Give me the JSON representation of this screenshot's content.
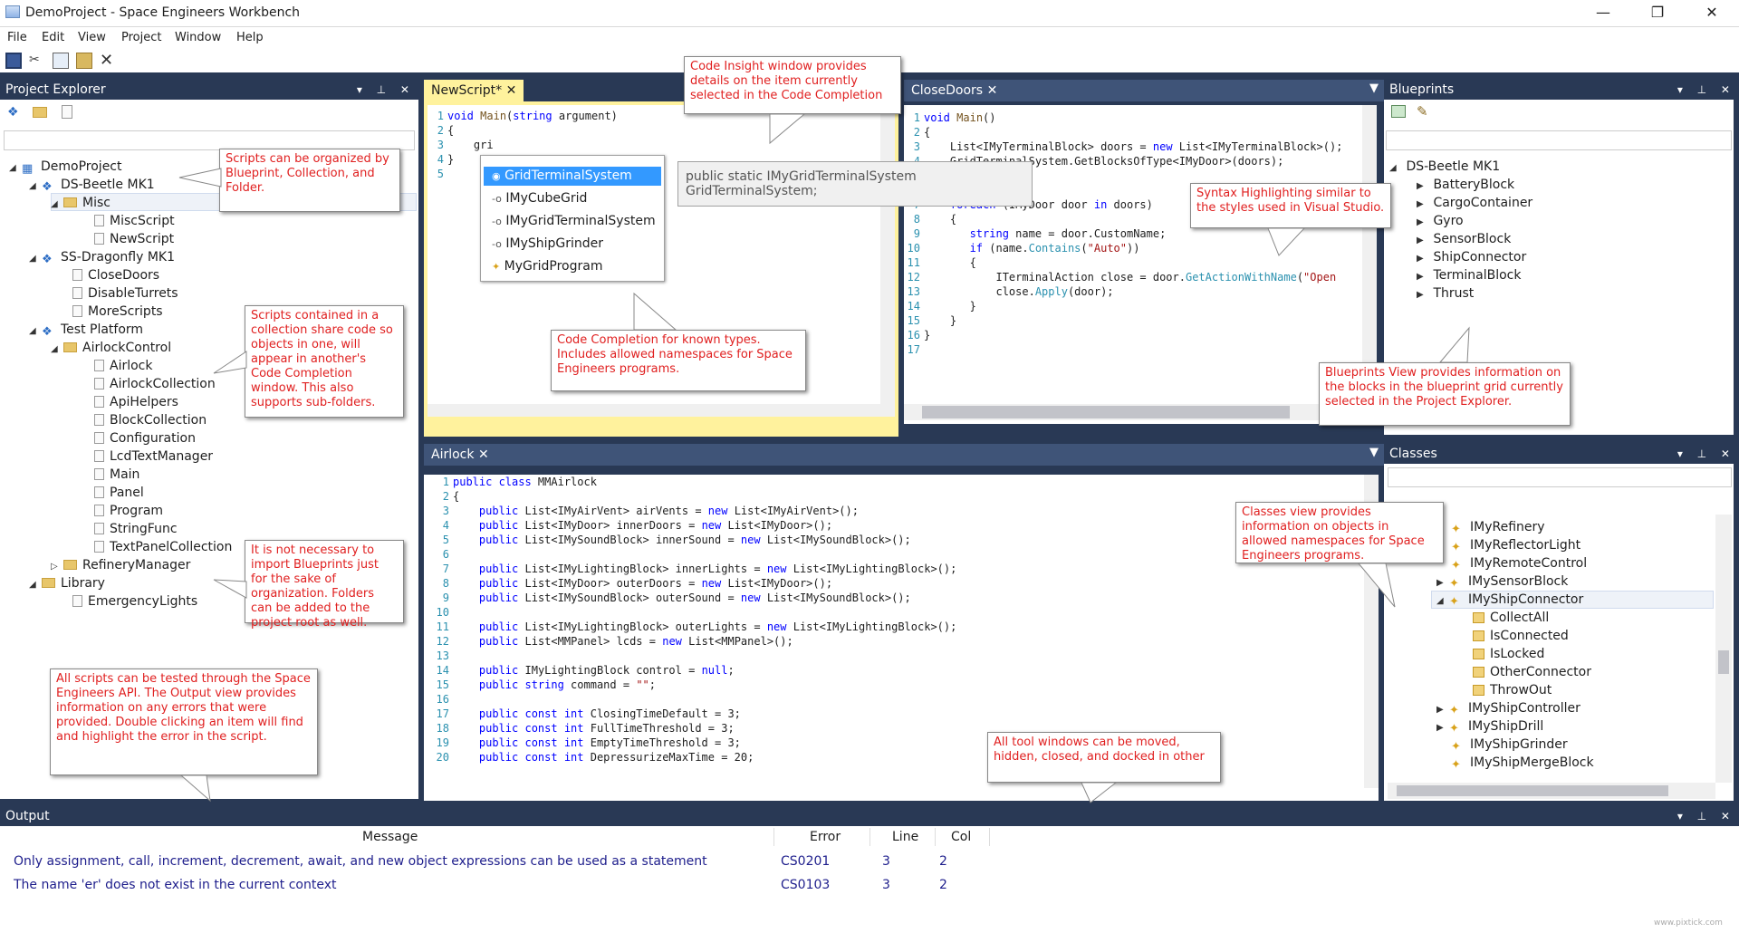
{
  "window": {
    "title": "DemoProject - Space Engineers Workbench"
  },
  "menu": [
    "File",
    "Edit",
    "View",
    "Project",
    "Window",
    "Help"
  ],
  "project_explorer": {
    "title": "Project Explorer",
    "items": [
      {
        "label": "DemoProject"
      },
      {
        "label": "DS-Beetle MK1"
      },
      {
        "label": "Misc"
      },
      {
        "label": "MiscScript"
      },
      {
        "label": "NewScript"
      },
      {
        "label": "SS-Dragonfly MK1"
      },
      {
        "label": "CloseDoors"
      },
      {
        "label": "DisableTurrets"
      },
      {
        "label": "MoreScripts"
      },
      {
        "label": "Test Platform"
      },
      {
        "label": "AirlockControl"
      },
      {
        "label": "Airlock"
      },
      {
        "label": "AirlockCollection"
      },
      {
        "label": "ApiHelpers"
      },
      {
        "label": "BlockCollection"
      },
      {
        "label": "Configuration"
      },
      {
        "label": "LcdTextManager"
      },
      {
        "label": "Main"
      },
      {
        "label": "Panel"
      },
      {
        "label": "Program"
      },
      {
        "label": "StringFunc"
      },
      {
        "label": "TextPanelCollection"
      },
      {
        "label": "RefineryManager"
      },
      {
        "label": "Library"
      },
      {
        "label": "EmergencyLights"
      }
    ]
  },
  "newscript": {
    "tab": "NewScript*",
    "completion": [
      "GridTerminalSystem",
      "IMyCubeGrid",
      "IMyGridTerminalSystem",
      "IMyShipGrinder",
      "MyGridProgram"
    ],
    "insight": "public static IMyGridTerminalSystem GridTerminalSystem;"
  },
  "closedoors": {
    "tab": "CloseDoors"
  },
  "airlock": {
    "tab": "Airlock"
  },
  "blueprints": {
    "title": "Blueprints",
    "root": "DS-Beetle MK1",
    "items": [
      "BatteryBlock",
      "CargoContainer",
      "Gyro",
      "SensorBlock",
      "ShipConnector",
      "TerminalBlock",
      "Thrust"
    ]
  },
  "classes": {
    "title": "Classes",
    "items": [
      "IMyRefinery",
      "IMyReflectorLight",
      "IMyRemoteControl",
      "IMySensorBlock",
      "IMyShipConnector"
    ],
    "members": [
      "CollectAll",
      "IsConnected",
      "IsLocked",
      "OtherConnector",
      "ThrowOut"
    ],
    "items2": [
      "IMyShipController",
      "IMyShipDrill",
      "IMyShipGrinder",
      "IMyShipMergeBlock"
    ]
  },
  "output": {
    "title": "Output",
    "columns": {
      "message": "Message",
      "error": "Error",
      "line": "Line",
      "col": "Col"
    },
    "rows": [
      {
        "message": "Only assignment, call, increment, decrement, await, and new object expressions can be used as a statement",
        "error": "CS0201",
        "line": "3",
        "col": "2"
      },
      {
        "message": "The name 'er' does not exist in the current context",
        "error": "CS0103",
        "line": "3",
        "col": "2"
      }
    ]
  },
  "callouts": {
    "organize": "Scripts can be organized by Blueprint, Collection, and Folder.",
    "collection": "Scripts contained in a collection share code so objects in one, will appear in another's Code Completion window. This also supports sub-folders.",
    "import": "It is not necessary to import Blueprints just for the sake of organization. Folders can be added to the project root as well.",
    "testing": "All scripts can be tested through the Space Engineers API. The Output view provides information on any errors that were provided. Double clicking an item will find and highlight the error in the script.",
    "insight": "Code Insight window provides details on the item currently selected in the Code Completion",
    "completion": "Code Completion for known types. Includes allowed namespaces for Space Engineers programs.",
    "syntax": "Syntax Highlighting similar to the styles used in Visual Studio.",
    "blueprints": "Blueprints View provides information on the blocks in the blueprint grid currently selected in the Project Explorer.",
    "classes": "Classes view provides information on objects in allowed namespaces for Space Engineers programs.",
    "tools": "All tool windows can be moved, hidden, closed, and docked in other"
  },
  "watermark": "www.pixtick.com"
}
